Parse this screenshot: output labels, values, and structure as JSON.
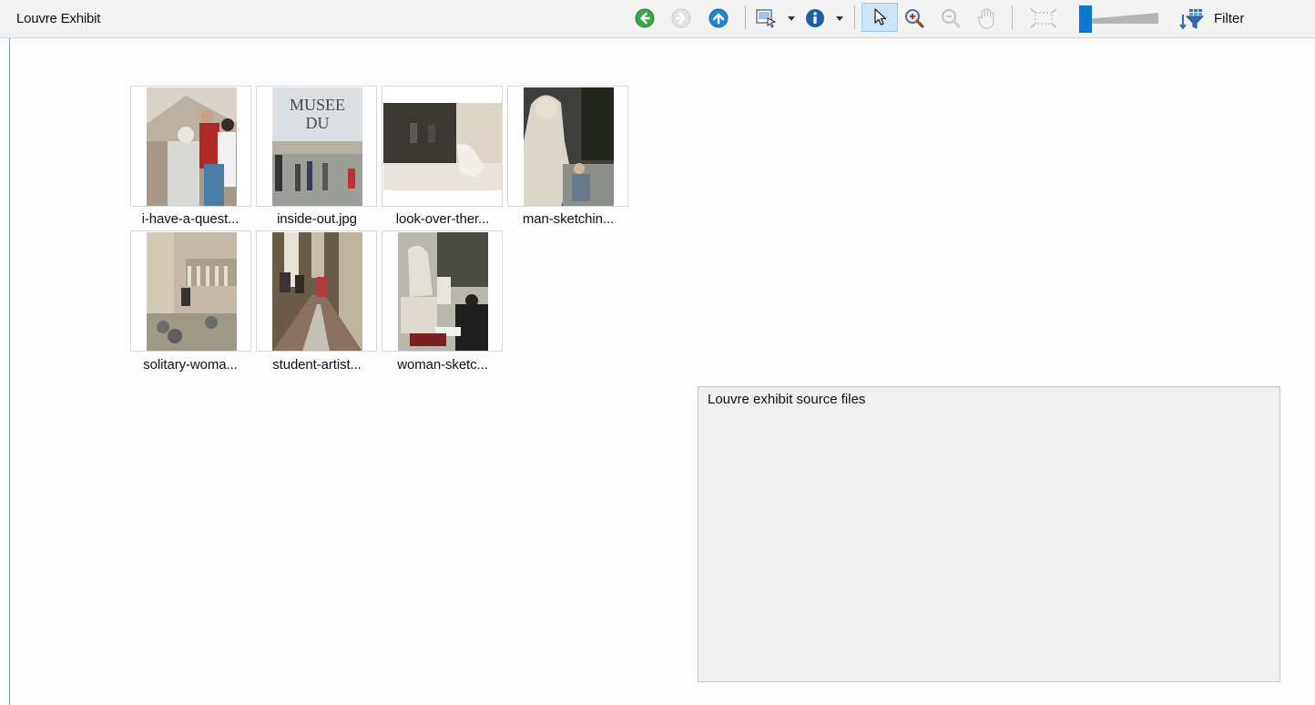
{
  "window": {
    "title": "Louvre Exhibit"
  },
  "toolbar": {
    "back_icon": "back-arrow-icon",
    "forward_icon": "forward-arrow-icon",
    "up_icon": "up-arrow-icon",
    "view_icon": "view-thumbnails-icon",
    "info_icon": "info-icon",
    "pointer_icon": "pointer-icon",
    "zoom_in_icon": "zoom-in-icon",
    "zoom_out_icon": "zoom-out-icon",
    "pan_icon": "hand-pan-icon",
    "fit_icon": "fit-to-window-icon",
    "filter_label": "Filter",
    "zoom_slider_level": 0.05,
    "colors": {
      "nav_green": "#3aa64a",
      "nav_blue": "#1d86d1",
      "nav_disabled": "#c8c8c8",
      "slider_blue": "#0a76d8"
    }
  },
  "gallery": {
    "items": [
      {
        "caption": "i-have-a-quest..."
      },
      {
        "caption": "inside-out.jpg"
      },
      {
        "caption": "look-over-ther..."
      },
      {
        "caption": "man-sketchin..."
      },
      {
        "caption": "solitary-woma..."
      },
      {
        "caption": "student-artist..."
      },
      {
        "caption": "woman-sketc..."
      }
    ],
    "museum_sign": "MUSEE DU"
  },
  "description_panel": {
    "text": "Louvre exhibit source files"
  }
}
